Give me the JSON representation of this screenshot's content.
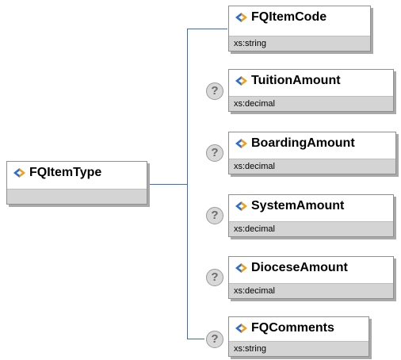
{
  "root": {
    "name": "FQItemType",
    "type": ""
  },
  "elements": [
    {
      "name": "FQItemCode",
      "type": "xs:string",
      "optional": false
    },
    {
      "name": "TuitionAmount",
      "type": "xs:decimal",
      "optional": true
    },
    {
      "name": "BoardingAmount",
      "type": "xs:decimal",
      "optional": true
    },
    {
      "name": "SystemAmount",
      "type": "xs:decimal",
      "optional": true
    },
    {
      "name": "DioceseAmount",
      "type": "xs:decimal",
      "optional": true
    },
    {
      "name": "FQComments",
      "type": "xs:string",
      "optional": true
    }
  ],
  "icons": {
    "element": "diamond-element-icon",
    "optional": "question-mark-icon"
  },
  "colors": {
    "connector": "#3b6fb0",
    "type_bar": "#d4d4d4",
    "diamond_left": "#2e6bd0",
    "diamond_right": "#f0a020"
  }
}
